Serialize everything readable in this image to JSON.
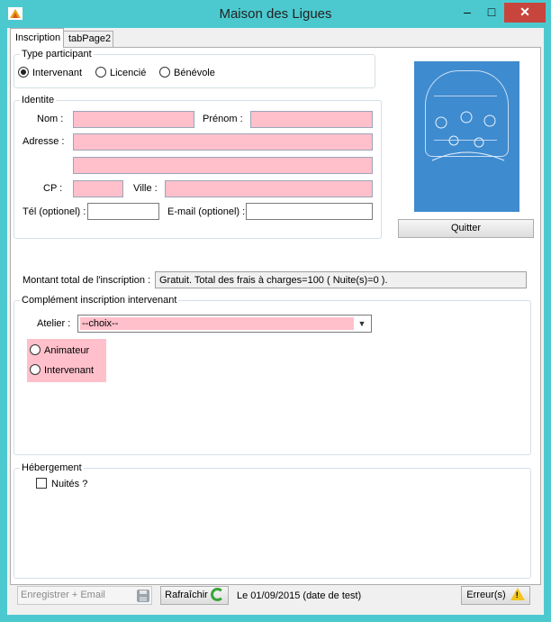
{
  "window": {
    "title": "Maison des Ligues",
    "minimize_glyph": "–",
    "maximize_glyph": "□",
    "close_glyph": "✕"
  },
  "tabs": [
    {
      "label": "Inscription",
      "active": true
    },
    {
      "label": "tabPage2",
      "active": false
    }
  ],
  "type_participant": {
    "title": "Type participant",
    "options": [
      {
        "label": "Intervenant",
        "checked": true
      },
      {
        "label": "Licencié",
        "checked": false
      },
      {
        "label": "Bénévole",
        "checked": false
      }
    ]
  },
  "identite": {
    "title": "Identite",
    "nom_label": "Nom :",
    "nom_value": "",
    "prenom_label": "Prénom :",
    "prenom_value": "",
    "adresse_label": "Adresse :",
    "adresse1_value": "",
    "adresse2_value": "",
    "cp_label": "CP :",
    "cp_value": "",
    "ville_label": "Ville :",
    "ville_value": "",
    "tel_label": "Tél (optionel) :",
    "tel_value": "",
    "email_label": "E-mail (optionel) :",
    "email_value": ""
  },
  "quit_button": "Quitter",
  "montant": {
    "label": "Montant total de l'inscription :",
    "value": "Gratuit. Total des frais à charges=100 ( Nuite(s)=0 )."
  },
  "complement": {
    "title": "Complément inscription intervenant",
    "atelier_label": "Atelier :",
    "atelier_selected": "--choix--",
    "roles": [
      {
        "label": "Animateur",
        "checked": false
      },
      {
        "label": "Intervenant",
        "checked": false
      }
    ]
  },
  "hebergement": {
    "title": "Hébergement",
    "nuites_label": "Nuités ?",
    "nuites_checked": false
  },
  "bottom": {
    "register_label": "Enregistrer + Email",
    "refresh_label": "Rafraîchir",
    "status": "Le 01/09/2015 (date de test)",
    "errors_label": "Erreur(s)",
    "warn_glyph": "!"
  },
  "colors": {
    "window_frame": "#4cc9cf",
    "required_field": "#ffc0cb",
    "close_button": "#c7453d"
  }
}
